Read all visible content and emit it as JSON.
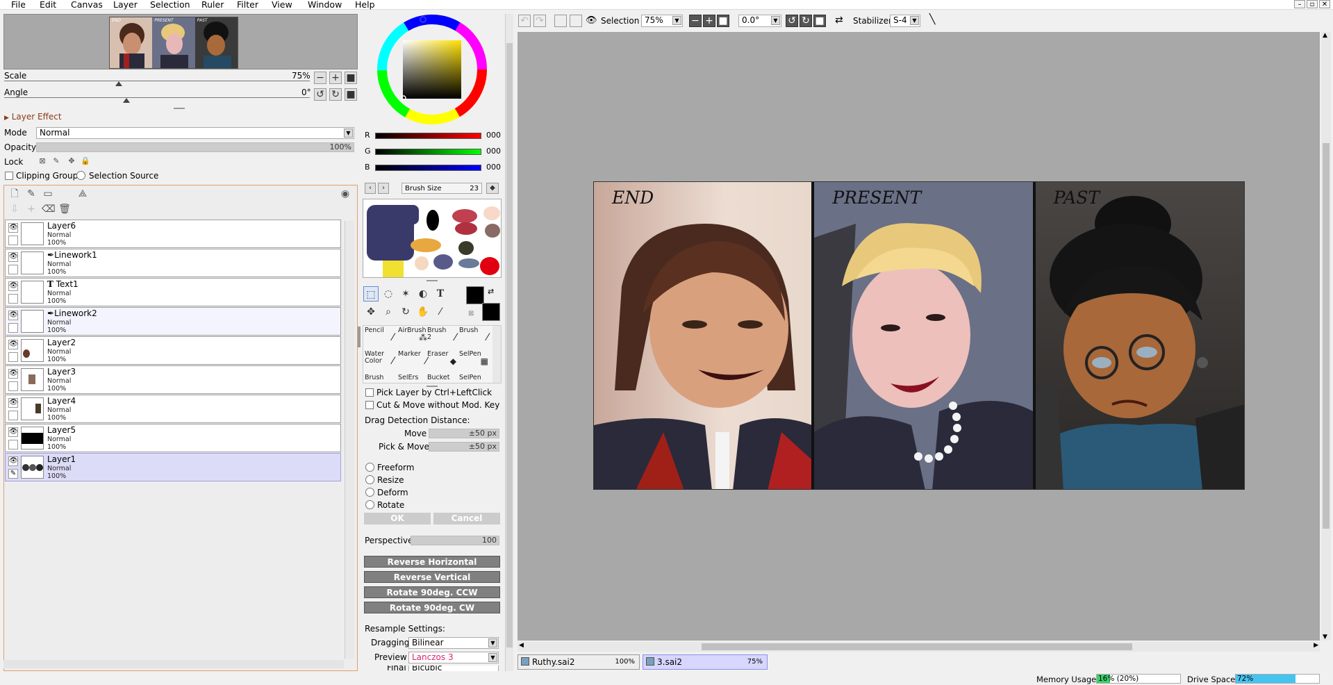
{
  "menu": [
    "File",
    "Edit",
    "Canvas",
    "Layer",
    "Selection",
    "Ruler",
    "Filter",
    "View",
    "Window",
    "Help"
  ],
  "window_buttons": [
    "–",
    "▫",
    "✕"
  ],
  "navigator": {
    "panel_labels": [
      "END",
      "PRESENT",
      "PAST"
    ],
    "scale_label": "Scale",
    "scale_value": "75%",
    "scale_fraction": 0.75,
    "angle_label": "Angle",
    "angle_value": "0°",
    "angle_fraction": 0.5
  },
  "layer_effect": {
    "header": "Layer Effect",
    "mode_label": "Mode",
    "mode_value": "Normal",
    "opacity_label": "Opacity",
    "opacity_value": "100%",
    "lock_label": "Lock",
    "clipping_label": "Clipping Group",
    "selection_source_label": "Selection Source"
  },
  "layers": [
    {
      "name": "Layer6",
      "mode": "Normal",
      "opacity": "100%",
      "icon": ""
    },
    {
      "name": "Linework1",
      "mode": "Normal",
      "opacity": "100%",
      "icon": "pen-icon"
    },
    {
      "name": "Text1",
      "mode": "Normal",
      "opacity": "100%",
      "icon": "text-icon"
    },
    {
      "name": "Linework2",
      "mode": "Normal",
      "opacity": "100%",
      "icon": "pen-icon"
    },
    {
      "name": "Layer2",
      "mode": "Normal",
      "opacity": "100%",
      "icon": ""
    },
    {
      "name": "Layer3",
      "mode": "Normal",
      "opacity": "100%",
      "icon": ""
    },
    {
      "name": "Layer4",
      "mode": "Normal",
      "opacity": "100%",
      "icon": ""
    },
    {
      "name": "Layer5",
      "mode": "Normal",
      "opacity": "100%",
      "icon": ""
    },
    {
      "name": "Layer1",
      "mode": "Normal",
      "opacity": "100%",
      "icon": ""
    }
  ],
  "color": {
    "r_label": "R",
    "r_value": "000",
    "g_label": "G",
    "g_value": "000",
    "b_label": "B",
    "b_value": "000",
    "foreground": "#000000",
    "background": "#000000"
  },
  "brush_size": {
    "label": "Brush Size",
    "value": "23"
  },
  "brushes": [
    {
      "name": "Pencil",
      "sub": ""
    },
    {
      "name": "AirBrush",
      "sub": ""
    },
    {
      "name": "Brush",
      "sub": "2"
    },
    {
      "name": "Brush",
      "sub": ""
    },
    {
      "name": "Water",
      "sub": "Color"
    },
    {
      "name": "Marker",
      "sub": ""
    },
    {
      "name": "Eraser",
      "sub": ""
    },
    {
      "name": "SelPen",
      "sub": ""
    },
    {
      "name": "Brush",
      "sub": ""
    },
    {
      "name": "SelErs",
      "sub": ""
    },
    {
      "name": "Bucket",
      "sub": ""
    },
    {
      "name": "SelPen",
      "sub": ""
    }
  ],
  "options": {
    "pick_layer": "Pick Layer by Ctrl+LeftClick",
    "cut_move": "Cut & Move without Mod. Key",
    "drag_detection": "Drag Detection Distance:",
    "move_label": "Move",
    "move_value": "±50 px",
    "pick_move_label": "Pick & Move",
    "pick_move_value": "±50 px",
    "freeform": "Freeform",
    "resize": "Resize",
    "deform": "Deform",
    "rotate": "Rotate",
    "ok": "OK",
    "cancel": "Cancel",
    "perspective_label": "Perspective",
    "perspective_value": "100",
    "reverse_h": "Reverse Horizontal",
    "reverse_v": "Reverse Vertical",
    "rotate_ccw": "Rotate 90deg. CCW",
    "rotate_cw": "Rotate 90deg. CW",
    "resample_header": "Resample Settings:",
    "dragging_label": "Dragging",
    "dragging_value": "Bilinear",
    "preview_label": "Preview",
    "preview_value": "Lanczos 3",
    "final_label": "Final",
    "final_value": "Bicubic"
  },
  "toolbar": {
    "selection_label": "Selection",
    "zoom_value": "75%",
    "angle_value": "0.0°",
    "stabilizer_label": "Stabilizer",
    "stabilizer_value": "S-4"
  },
  "artwork_captions": [
    "END",
    "PRESENT",
    "PAST"
  ],
  "documents": [
    {
      "name": "Ruthy.sai2",
      "zoom": "100%"
    },
    {
      "name": "3.sai2",
      "zoom": "75%"
    }
  ],
  "status": {
    "memory_label": "Memory Usage",
    "memory_value": "16% (20%)",
    "memory_fraction": 0.16,
    "drive_label": "Drive Space",
    "drive_value": "72%",
    "drive_fraction": 0.72
  }
}
